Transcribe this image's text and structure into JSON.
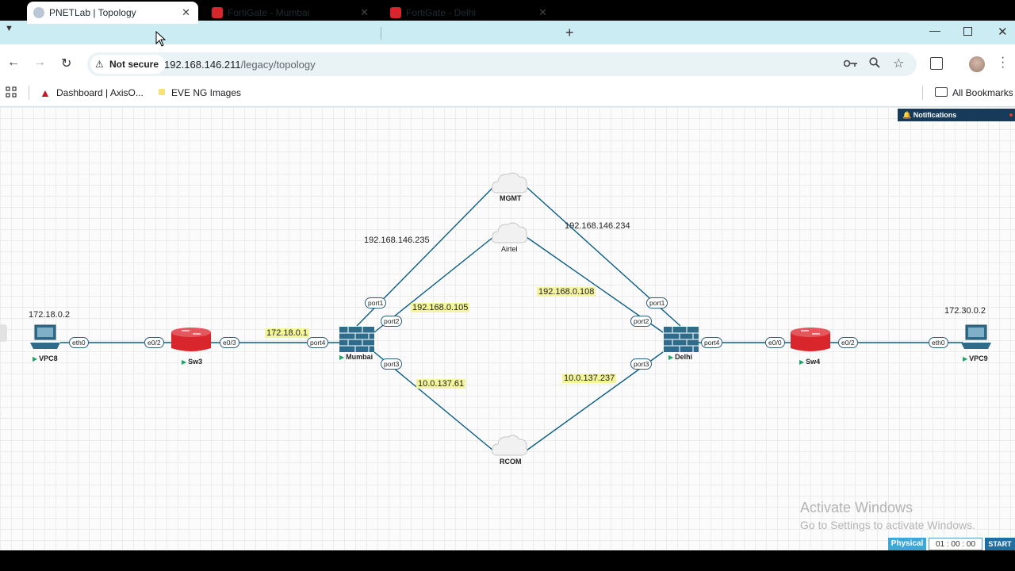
{
  "browser": {
    "tabs": [
      {
        "title": "PNETLab | Topology",
        "active": true
      },
      {
        "title": "FortiGate - Mumbai",
        "active": false
      },
      {
        "title": "FortiGate - Delhi",
        "active": false
      }
    ],
    "not_secure": "Not secure",
    "url_host": "192.168.146.211",
    "url_path": "/legacy/topology",
    "bookmarks": [
      "Dashboard | AxisO...",
      "EVE NG Images"
    ],
    "all_bookmarks": "All Bookmarks"
  },
  "notifications": "Notifications",
  "nodes": {
    "vpc8": "VPC8",
    "sw3": "Sw3",
    "mumbai": "Mumbai",
    "mgmt": "MGMT",
    "airtel": "Airtel",
    "rcom": "RCOM",
    "delhi": "Delhi",
    "sw4": "Sw4",
    "vpc9": "VPC9"
  },
  "ports": {
    "vpc8_eth0": "eth0",
    "sw3_e02": "e0/2",
    "sw3_e03": "e0/3",
    "mum_port4": "port4",
    "mum_port1": "port1",
    "mum_port2": "port2",
    "mum_port3": "port3",
    "del_port1": "port1",
    "del_port2": "port2",
    "del_port3": "port3",
    "del_port4": "port4",
    "sw4_e00": "e0/0",
    "sw4_e02": "e0/2",
    "vpc9_eth0": "eth0"
  },
  "ip_labels": {
    "vpc8": "172.18.0.2",
    "mum_port4": "172.18.0.1",
    "mum_mgmt": "192.168.146.235",
    "del_mgmt": "192.168.146.234",
    "mum_airtel": "192.168.0.105",
    "del_airtel": "192.168.0.108",
    "mum_rcom": "10.0.137.61",
    "del_rcom": "10.0.137.237",
    "vpc9": "172.30.0.2"
  },
  "watermark": {
    "title": "Activate Windows",
    "subtitle": "Go to Settings to activate Windows."
  },
  "bottom": {
    "mode": "Physical",
    "time": "01 : 00 : 00",
    "start": "START"
  },
  "colors": {
    "link": "#0b5d85",
    "highlight": "#f4f49a",
    "switch_red": "#d9262c",
    "tab_bg": "#ccecf3"
  }
}
